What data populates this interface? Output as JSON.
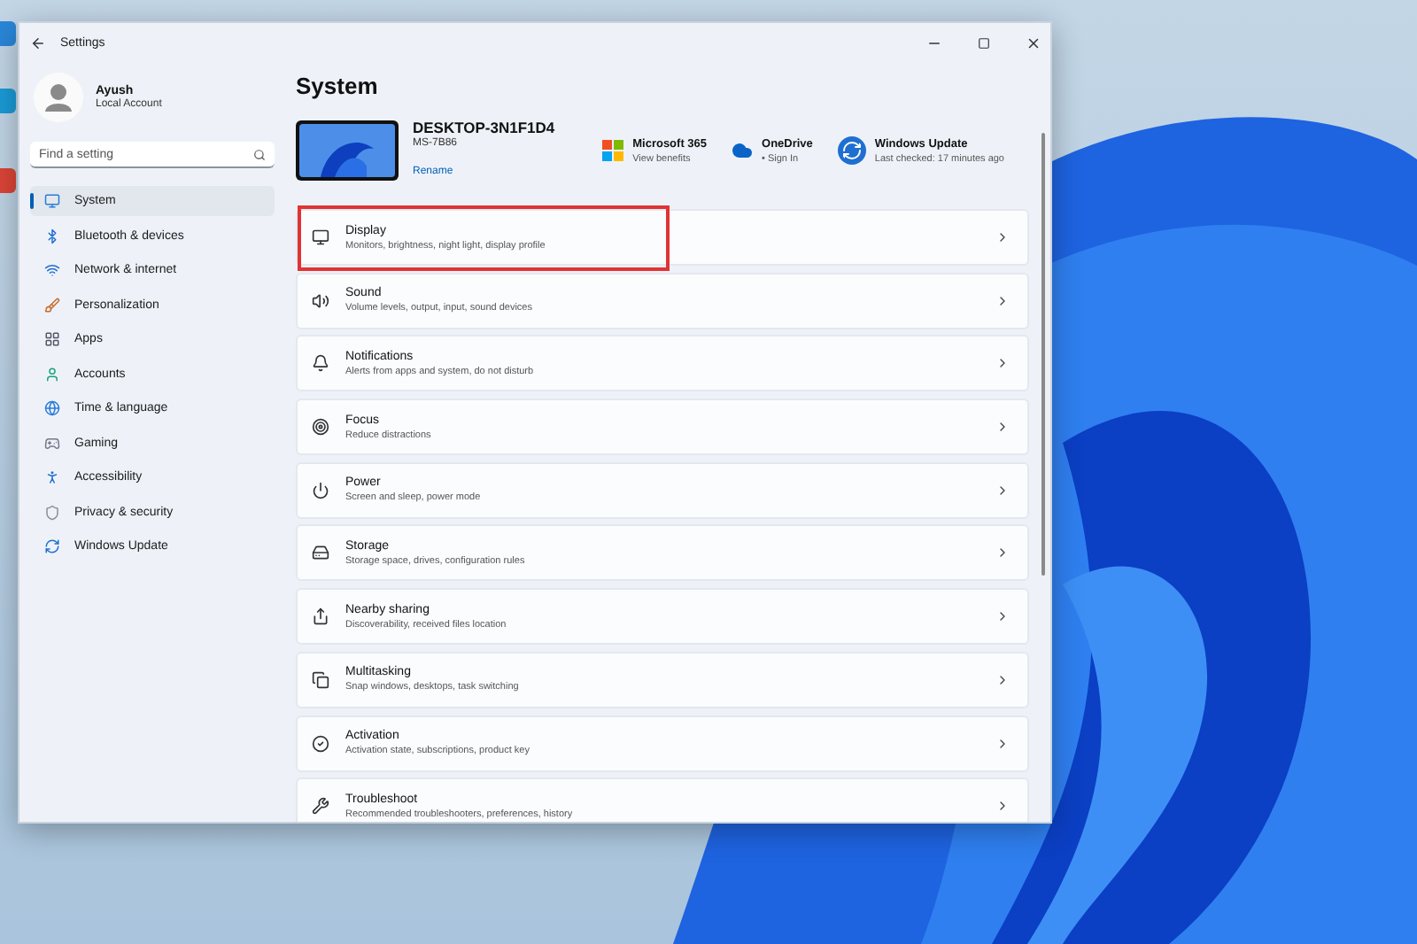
{
  "window": {
    "title": "Settings"
  },
  "profile": {
    "name": "Ayush",
    "account_type": "Local Account"
  },
  "search": {
    "placeholder": "Find a setting"
  },
  "nav": [
    {
      "label": "System",
      "selected": true
    },
    {
      "label": "Bluetooth & devices",
      "selected": false
    },
    {
      "label": "Network & internet",
      "selected": false
    },
    {
      "label": "Personalization",
      "selected": false
    },
    {
      "label": "Apps",
      "selected": false
    },
    {
      "label": "Accounts",
      "selected": false
    },
    {
      "label": "Time & language",
      "selected": false
    },
    {
      "label": "Gaming",
      "selected": false
    },
    {
      "label": "Accessibility",
      "selected": false
    },
    {
      "label": "Privacy & security",
      "selected": false
    },
    {
      "label": "Windows Update",
      "selected": false
    }
  ],
  "page_title": "System",
  "device": {
    "name": "DESKTOP-3N1F1D4",
    "model": "MS-7B86",
    "rename": "Rename"
  },
  "quick_links": [
    {
      "title": "Microsoft 365",
      "subtitle": "View benefits"
    },
    {
      "title": "OneDrive",
      "subtitle": "• Sign In"
    },
    {
      "title": "Windows Update",
      "subtitle": "Last checked: 17 minutes ago"
    }
  ],
  "settings": [
    {
      "title": "Display",
      "subtitle": "Monitors, brightness, night light, display profile",
      "highlighted": true
    },
    {
      "title": "Sound",
      "subtitle": "Volume levels, output, input, sound devices",
      "highlighted": false
    },
    {
      "title": "Notifications",
      "subtitle": "Alerts from apps and system, do not disturb",
      "highlighted": false
    },
    {
      "title": "Focus",
      "subtitle": "Reduce distractions",
      "highlighted": false
    },
    {
      "title": "Power",
      "subtitle": "Screen and sleep, power mode",
      "highlighted": false
    },
    {
      "title": "Storage",
      "subtitle": "Storage space, drives, configuration rules",
      "highlighted": false
    },
    {
      "title": "Nearby sharing",
      "subtitle": "Discoverability, received files location",
      "highlighted": false
    },
    {
      "title": "Multitasking",
      "subtitle": "Snap windows, desktops, task switching",
      "highlighted": false
    },
    {
      "title": "Activation",
      "subtitle": "Activation state, subscriptions, product key",
      "highlighted": false
    },
    {
      "title": "Troubleshoot",
      "subtitle": "Recommended troubleshooters, preferences, history",
      "highlighted": false
    }
  ]
}
